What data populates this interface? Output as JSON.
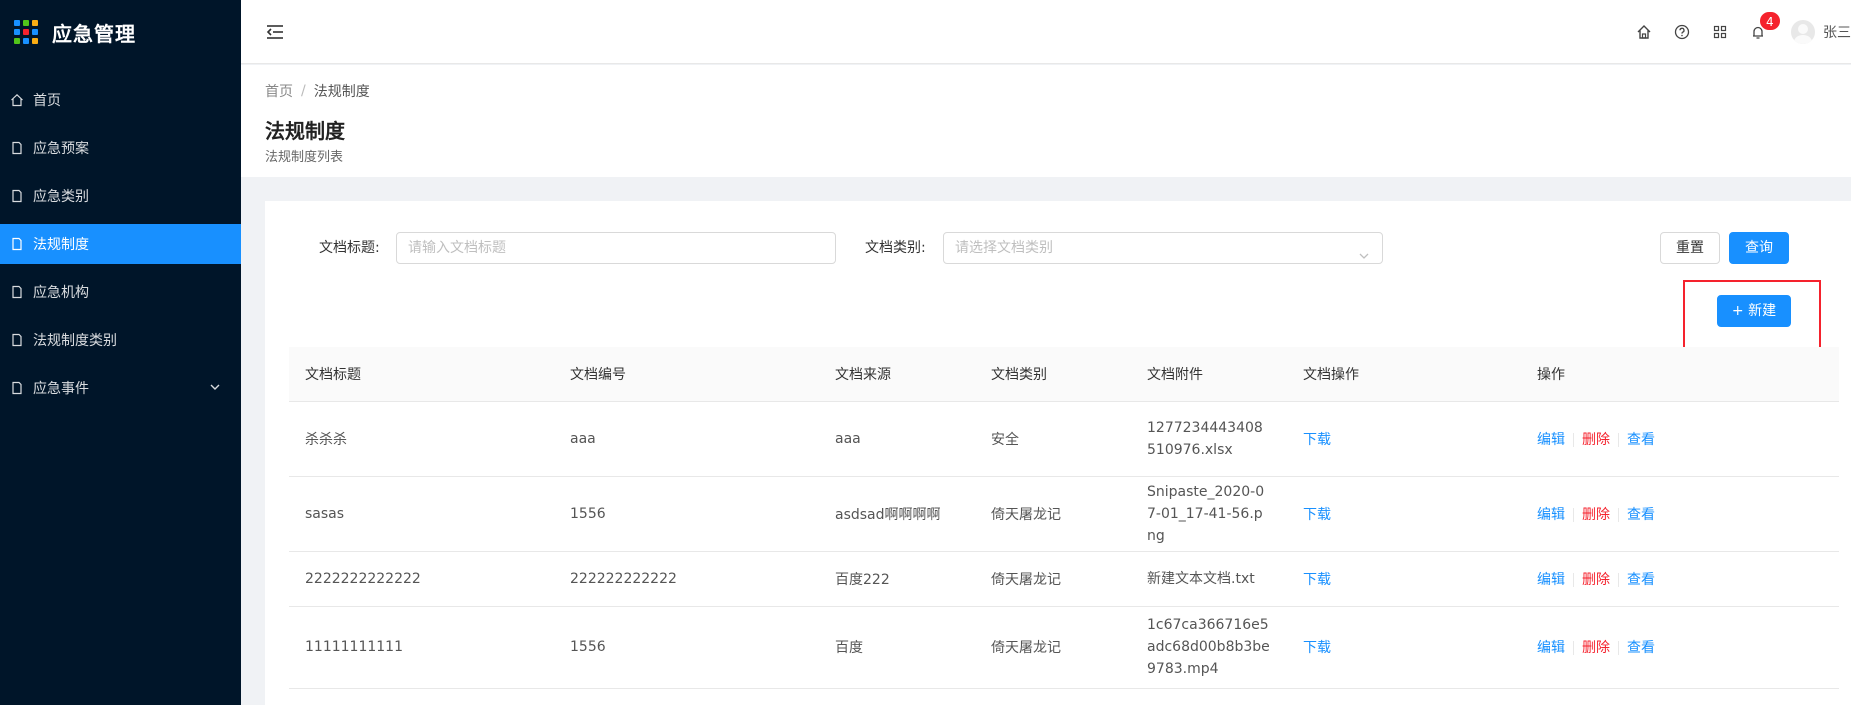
{
  "app": {
    "title": "应急管理",
    "logo_colors": [
      "#1890ff",
      "#52c41a",
      "#faad14",
      "#1890ff",
      "#f5222d",
      "#1890ff",
      "#52c41a",
      "#1890ff",
      "#faad14"
    ]
  },
  "sidebar": {
    "items": [
      {
        "label": "首页",
        "icon": "home-icon"
      },
      {
        "label": "应急预案",
        "icon": "file-icon"
      },
      {
        "label": "应急类别",
        "icon": "file-icon"
      },
      {
        "label": "法规制度",
        "icon": "file-icon",
        "active": true
      },
      {
        "label": "应急机构",
        "icon": "file-icon"
      },
      {
        "label": "法规制度类别",
        "icon": "file-icon"
      },
      {
        "label": "应急事件",
        "icon": "file-icon",
        "expandable": true
      }
    ]
  },
  "header": {
    "notification_count": "4",
    "user_name": "张三",
    "icons": [
      "home-icon",
      "question-icon",
      "apps-icon",
      "bell-icon"
    ]
  },
  "page": {
    "breadcrumb": [
      "首页",
      "法规制度"
    ],
    "title": "法规制度",
    "subtitle": "法规制度列表"
  },
  "search": {
    "title_label": "文档标题:",
    "title_placeholder": "请输入文档标题",
    "type_label": "文档类别:",
    "type_placeholder": "请选择文档类别",
    "reset_label": "重置",
    "query_label": "查询",
    "new_label": "+ 新建"
  },
  "table": {
    "columns": [
      "文档标题",
      "文档编号",
      "文档来源",
      "文档类别",
      "文档附件",
      "文档操作",
      "操作"
    ],
    "rows": [
      {
        "title": "杀杀杀",
        "code": "aaa",
        "source": "aaa",
        "type": "安全",
        "attachment": "1277234443408510976.xlsx",
        "doc_action": "下载"
      },
      {
        "title": "sasas",
        "code": "1556",
        "source": "asdsad啊啊啊啊",
        "type": "倚天屠龙记",
        "attachment": "Snipaste_2020-07-01_17-41-56.png",
        "doc_action": "下载"
      },
      {
        "title": "2222222222222",
        "code": "222222222222",
        "source": "百度222",
        "type": "倚天屠龙记",
        "attachment": "新建文本文档.txt",
        "doc_action": "下载"
      },
      {
        "title": "11111111111",
        "code": "1556",
        "source": "百度",
        "type": "倚天屠龙记",
        "attachment": "1c67ca366716e5adc68d00b8b3be9783.mp4",
        "doc_action": "下载"
      }
    ],
    "row_actions": {
      "edit": "编辑",
      "delete": "删除",
      "view": "查看"
    }
  }
}
